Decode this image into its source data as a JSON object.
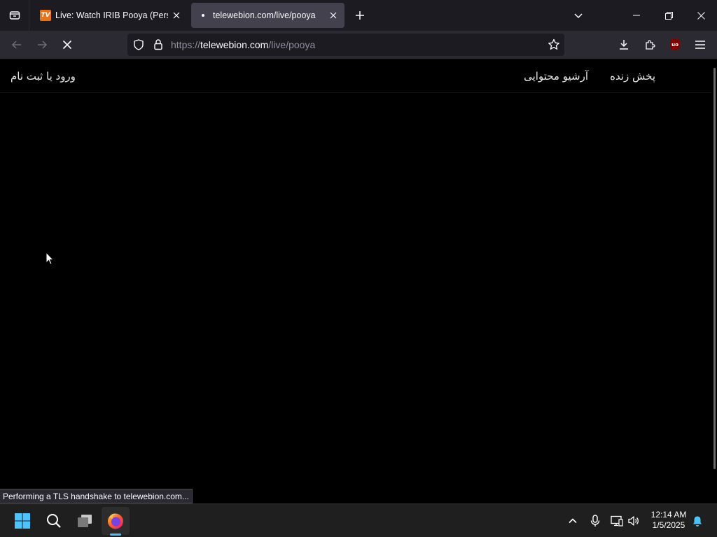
{
  "browser": {
    "tabs": [
      {
        "title": "Live: Watch IRIB Pooya (Persian",
        "favicon_text": "TV",
        "active": false
      },
      {
        "title": "telewebion.com/live/pooya",
        "active": true
      }
    ],
    "url": {
      "scheme": "https://",
      "host": "telewebion.com",
      "path": "/live/pooya"
    },
    "status_text": "Performing a TLS handshake to telewebion.com...",
    "extension_badge": "uo"
  },
  "site": {
    "nav": {
      "live": "پخش زنده",
      "archive": "آرشیو محتوایی",
      "login": "ورود یا ثبت نام"
    }
  },
  "taskbar": {
    "time": "12:14 AM",
    "date": "1/5/2025"
  },
  "colors": {
    "accent": "#4cc2ff",
    "tab_active_bg": "#42414d",
    "toolbar_bg": "#2b2a33",
    "favicon_orange": "#e8741a"
  }
}
